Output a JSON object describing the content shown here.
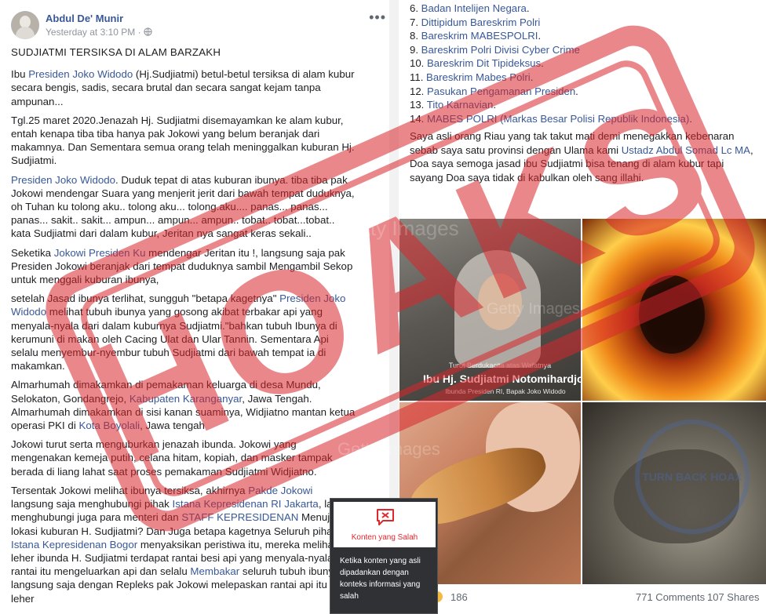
{
  "post": {
    "author": "Abdul De' Munir",
    "timestamp": "Yesterday at 3:10 PM · ",
    "privacy_icon": "globe-icon",
    "more_icon": "ellipsis-icon",
    "more_label": "•••",
    "paragraphs": [
      {
        "runs": [
          {
            "t": "SUDJIATMI TERSIKSA DI ALAM BARZAKH"
          }
        ]
      },
      {
        "runs": [
          {
            "t": "Ibu "
          },
          {
            "t": "Presiden Joko Widodo",
            "link": true
          },
          {
            "t": " (Hj.Sudjiatmi) betul-betul tersiksa di alam kubur secara bengis, sadis, secara brutal dan secara sangat kejam tanpa ampunan..."
          }
        ]
      },
      {
        "runs": [
          {
            "t": "Tgl.25 maret 2020.Jenazah Hj. Sudjiatmi disemayamkan ke alam kubur, entah kenapa tiba tiba hanya pak Jokowi yang belum beranjak dari makamnya. Dan Sementara semua orang telah meninggalkan kuburan Hj. Sudjiatmi."
          }
        ]
      },
      {
        "runs": [
          {
            "t": "Presiden Joko Widodo",
            "link": true
          },
          {
            "t": ". Duduk tepat di atas kuburan ibunya. tiba tiba pak Jokowi mendengar Suara yang menjerit jerit dari bawah tempat duduknya, oh Tuhan ku tolong aku.. tolong aku... tolong.aku.... panas... panas... panas... sakit.. sakit... ampun... ampun... ampun.. tobat.. tobat...tobat.. kata Sudjiatmi dari dalam kubur, Jeritan nya sangat keras sekali.."
          }
        ]
      },
      {
        "runs": [
          {
            "t": "Seketika "
          },
          {
            "t": "Jokowi Presiden Ku",
            "link": true
          },
          {
            "t": " mendengar Jeritan itu !, langsung saja pak Presiden Jokowi beranjak dari tempat duduknya sambil Mengambil Sekop untuk menggali kuburan ibunya,"
          }
        ]
      },
      {
        "runs": [
          {
            "t": "setelah Jasad ibunya terlihat, sungguh \"betapa kagetnya\" "
          },
          {
            "t": "Presiden Joko Widodo",
            "link": true
          },
          {
            "t": " melihat tubuh ibunya yang gosong akibat terbakar api yang menyala-nyala dari dalam kuburnya Sudjiatmi.\"bahkan tubuh Ibunya di kerumuni di makan oleh Cacing Ulat dan Ular Tannin. Sementara Api selalu menyembur-nyembur tubuh Sudjiatmi dari bawah tempat ia di makamkan."
          }
        ]
      },
      {
        "runs": [
          {
            "t": "Almarhumah dimakamkan di pemakaman keluarga di desa Mundu, Selokaton, Gondangrejo, "
          },
          {
            "t": "Kabupaten Karanganyar",
            "link": true
          },
          {
            "t": ", Jawa Tengah. Almarhumah dimakamkan di sisi kanan suaminya, Widjiatno mantan ketua operasi PKI di "
          },
          {
            "t": "Kota Boyolali",
            "link": true
          },
          {
            "t": ", Jawa tengah"
          }
        ]
      },
      {
        "runs": [
          {
            "t": "Jokowi turut serta menguburkan jenazah ibunda. Jokowi yang mengenakan kemeja putih, celana hitam, kopiah, dan masker tampak berada di liang lahat saat proses pemakaman Sudjiatmi Widjiatno."
          }
        ]
      },
      {
        "runs": [
          {
            "t": "Tersentak Jokowi melihat ibunya tersiksa, akhirnya "
          },
          {
            "t": "Pakde Jokowi",
            "link": true
          },
          {
            "t": " langsung saja menghubungi pihak "
          },
          {
            "t": "Istana Kepresidenan RI Jakarta",
            "link": true
          },
          {
            "t": ", lalu menghubungi juga para menteri dan "
          },
          {
            "t": "STAFF KEPRESIDENAN",
            "link": true
          },
          {
            "t": " Menuju ke lokasi kuburan H. Sudjiatmi? Dan Juga betapa kagetnya Seluruh pihak "
          },
          {
            "t": "Istana Kepresidenan Bogor",
            "link": true
          },
          {
            "t": " menyaksikan peristiwa itu, mereka melihat leher ibunda H. Sudjiatmi terdapat rantai besi api yang menyala-nyala, rantai itu mengeluarkan api dan selalu "
          },
          {
            "t": "Membakar",
            "link": true
          },
          {
            "t": " seluruh tubuh ibunya, langsung saja dengan Repleks pak Jokowi melepaskan rantai api itu dari leher"
          }
        ]
      }
    ]
  },
  "continuation": {
    "list": [
      {
        "n": "6. ",
        "runs": [
          {
            "t": "Badan Intelijen Negara",
            "link": true
          },
          {
            "t": "."
          }
        ]
      },
      {
        "n": "7. ",
        "runs": [
          {
            "t": "Dittipidum Bareskrim Polri",
            "link": true
          }
        ]
      },
      {
        "n": "8. ",
        "runs": [
          {
            "t": "Bareskrim MABESPOLRI",
            "link": true
          },
          {
            "t": "."
          }
        ]
      },
      {
        "n": "9. ",
        "runs": [
          {
            "t": "Bareskrim Polri Divisi Cyber Crime",
            "link": true
          }
        ]
      },
      {
        "n": "10. ",
        "runs": [
          {
            "t": "Bareskrim Dit Tipideksus",
            "link": true
          },
          {
            "t": "."
          }
        ]
      },
      {
        "n": "11. ",
        "runs": [
          {
            "t": "Bareskrim Mabes Polri",
            "link": true
          },
          {
            "t": "."
          }
        ]
      },
      {
        "n": "12. ",
        "runs": [
          {
            "t": "Pasukan Pengamanan Presiden",
            "link": true
          },
          {
            "t": "."
          }
        ]
      },
      {
        "n": "13. ",
        "runs": [
          {
            "t": "Tito Karnavian",
            "link": true
          },
          {
            "t": "."
          }
        ]
      },
      {
        "n": "14. ",
        "runs": [
          {
            "t": "MABES POLRI (Markas Besar Polisi Republik Indonesia)",
            "link": true
          },
          {
            "t": "."
          }
        ]
      }
    ],
    "closing": [
      {
        "runs": [
          {
            "t": "Saya asli orang Riau yang tak takut mati demi menegakkan kebenaran sebab saya satu provinsi dengan Ulama kami "
          },
          {
            "t": "Ustadz Abdul Somad Lc MA",
            "link": true
          },
          {
            "t": ", Doa saya semoga jasad ibu Sudjiatmi bisa tenang di alam kubur tapi sayang Doa saya tidak di kabulkan oleh sang illahi."
          }
        ]
      }
    ]
  },
  "photos": {
    "caption_small": "Turut Berdukacita atas Wafatnya",
    "caption_big": "Ibu Hj. Sudjiatmi Notomihardjo",
    "caption_sub": "Ibunda Presiden RI, Bapak Joko Widodo"
  },
  "stats": {
    "reactions": "186",
    "comments": "771 Comments",
    "shares": "107 Shares"
  },
  "stamp": {
    "text": "HOAKS",
    "watermark_1": "Getty Images",
    "watermark_2": "TURN BACK HOAX",
    "color": "#d8262b"
  },
  "warning": {
    "title": "Konten yang Salah",
    "description": "Ketika konten yang asli dipadankan dengan konteks informasi yang salah",
    "icon": "broken-message-icon"
  }
}
